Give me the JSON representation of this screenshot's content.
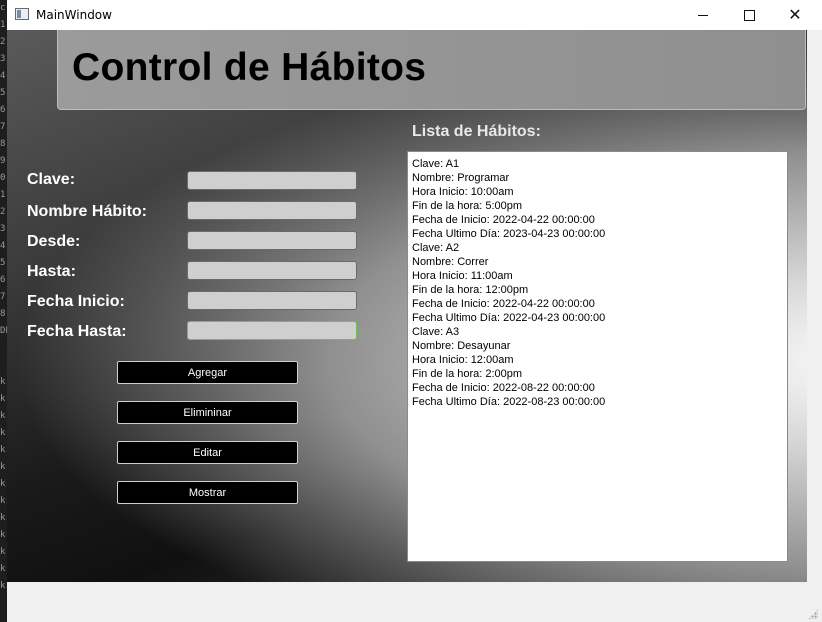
{
  "window": {
    "title": "MainWindow",
    "minimize_symbol": "",
    "close_symbol": "✕"
  },
  "background_strip": {
    "glyphs": [
      "c",
      "1",
      "2",
      "3",
      "4",
      "5",
      "6",
      "7",
      "8",
      "9",
      "0",
      "1",
      "2",
      "3",
      "4",
      "5",
      "6",
      "7",
      "8",
      "DE",
      "",
      "",
      "kr",
      "kr",
      "kr",
      "kr",
      "kr",
      "kr",
      "kr",
      "kr",
      "kr",
      "kr",
      "kr",
      "kr",
      "kr"
    ]
  },
  "header": {
    "title": "Control de Hábitos"
  },
  "form": {
    "fields": [
      {
        "label": "Clave:",
        "value": ""
      },
      {
        "label": "Nombre Hábito:",
        "value": ""
      },
      {
        "label": "Desde:",
        "value": ""
      },
      {
        "label": "Hasta:",
        "value": ""
      },
      {
        "label": "Fecha Inicio:",
        "value": ""
      },
      {
        "label": "Fecha Hasta:",
        "value": ""
      }
    ],
    "buttons": {
      "add": "Agregar",
      "delete": "Elimininar",
      "edit": "Editar",
      "show": "Mostrar"
    }
  },
  "habit_list": {
    "title": "Lista de Hábitos:",
    "lines": [
      "Clave: A1",
      "Nombre: Programar",
      "Hora Inicio: 10:00am",
      "Fin de la hora: 5:00pm",
      "Fecha de Inicio: 2022-04-22 00:00:00",
      "Fecha Ultimo Día: 2023-04-23 00:00:00",
      "Clave: A2",
      "Nombre: Correr",
      "Hora Inicio: 11:00am",
      "Fin de la hora: 12:00pm",
      "Fecha de Inicio: 2022-04-22 00:00:00",
      "Fecha Ultimo Día: 2022-04-23 00:00:00",
      "Clave: A3",
      "Nombre: Desayunar",
      "Hora Inicio: 12:00am",
      "Fin de la hora: 2:00pm",
      "Fecha de Inicio: 2022-08-22 00:00:00",
      "Fecha Ultimo Día: 2022-08-23 00:00:00"
    ]
  },
  "colors": {
    "button_bg": "#000000",
    "label_text": "#ffffff",
    "focused_border": "#6fbf4f"
  }
}
